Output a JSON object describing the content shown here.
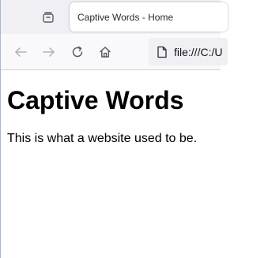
{
  "tab": {
    "title": "Captive Words - Home"
  },
  "toolbar": {
    "back_icon": "back-arrow-icon",
    "forward_icon": "forward-arrow-icon",
    "reload_icon": "reload-icon",
    "home_icon": "home-icon",
    "page_icon": "page-document-icon",
    "tab_overview_icon": "tab-overview-icon"
  },
  "address_bar": {
    "url": "file:///C:/U"
  },
  "page": {
    "heading": "Captive Words",
    "paragraph": "This is what a website used to be."
  },
  "colors": {
    "tabbar_bg": "#f0f0f4",
    "navbar_bg": "#f9f9fb",
    "icon_active": "#5b5b66",
    "icon_disabled": "#b0b0b8"
  }
}
